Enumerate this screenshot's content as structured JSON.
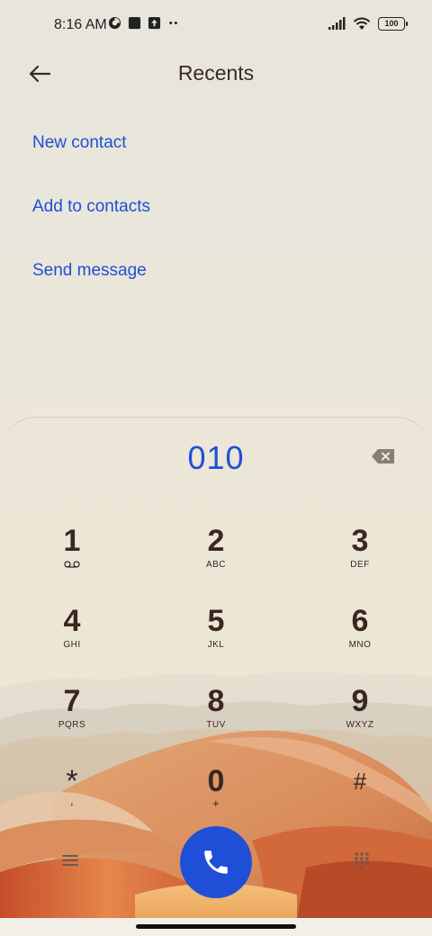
{
  "status_bar": {
    "time": "8:16 AM",
    "battery": "100",
    "icons_left": [
      "data-saver-icon",
      "square-notification-icon",
      "upload-icon",
      "more-dots-icon"
    ],
    "icons_right": [
      "signal-icon",
      "wifi-icon",
      "battery-icon"
    ]
  },
  "header": {
    "title": "Recents",
    "back_icon": "arrow-left-icon"
  },
  "actions": [
    {
      "label": "New contact"
    },
    {
      "label": "Add to contacts"
    },
    {
      "label": "Send message"
    }
  ],
  "dialer": {
    "number": "010",
    "keys": [
      {
        "digit": "1",
        "letters": ""
      },
      {
        "digit": "2",
        "letters": "ABC"
      },
      {
        "digit": "3",
        "letters": "DEF"
      },
      {
        "digit": "4",
        "letters": "GHI"
      },
      {
        "digit": "5",
        "letters": "JKL"
      },
      {
        "digit": "6",
        "letters": "MNO"
      },
      {
        "digit": "7",
        "letters": "PQRS"
      },
      {
        "digit": "8",
        "letters": "TUV"
      },
      {
        "digit": "9",
        "letters": "WXYZ"
      },
      {
        "digit": "*",
        "letters": ","
      },
      {
        "digit": "0",
        "letters": "+"
      },
      {
        "digit": "#",
        "letters": ""
      }
    ]
  },
  "colors": {
    "accent": "#1f4fd6",
    "text_dark": "#3a2622"
  }
}
